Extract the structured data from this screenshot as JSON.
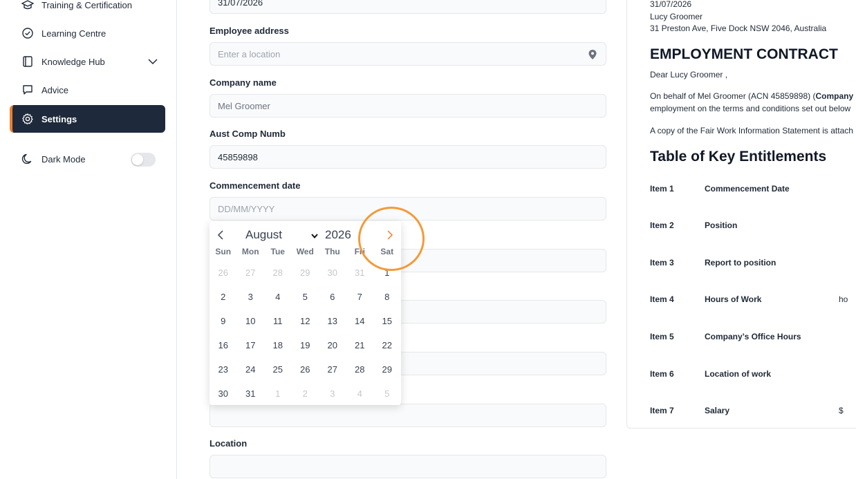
{
  "sidebar": {
    "items": [
      {
        "label": "Training & Certification",
        "icon": "graduation-cap-icon"
      },
      {
        "label": "Learning Centre",
        "icon": "check-circle-icon"
      },
      {
        "label": "Knowledge Hub",
        "icon": "book-icon"
      },
      {
        "label": "Advice",
        "icon": "chat-bubble-icon"
      },
      {
        "label": "Settings",
        "icon": "gear-icon"
      }
    ],
    "dark_mode_label": "Dark Mode",
    "dark_mode_on": false,
    "accent_color": "#f07f2d",
    "active_bg": "#1e2a3b"
  },
  "form": {
    "top_value": "31/07/2026",
    "employee_address": {
      "label": "Employee address",
      "placeholder": "Enter a location"
    },
    "company_name": {
      "label": "Company name",
      "value": "Mel Groomer"
    },
    "aust_comp_numb": {
      "label": "Aust Comp Numb",
      "value": "45859898"
    },
    "commencement_date": {
      "label": "Commencement date",
      "placeholder": "DD/MM/YYYY"
    },
    "location": {
      "label": "Location"
    }
  },
  "calendar": {
    "month": "August",
    "year": "2026",
    "weekdays": [
      "Sun",
      "Mon",
      "Tue",
      "Wed",
      "Thu",
      "Fri",
      "Sat"
    ],
    "weeks": [
      [
        "26",
        "27",
        "28",
        "29",
        "30",
        "31",
        "1"
      ],
      [
        "2",
        "3",
        "4",
        "5",
        "6",
        "7",
        "8"
      ],
      [
        "9",
        "10",
        "11",
        "12",
        "13",
        "14",
        "15"
      ],
      [
        "16",
        "17",
        "18",
        "19",
        "20",
        "21",
        "22"
      ],
      [
        "23",
        "24",
        "25",
        "26",
        "27",
        "28",
        "29"
      ],
      [
        "30",
        "31",
        "1",
        "2",
        "3",
        "4",
        "5"
      ]
    ]
  },
  "preview": {
    "date": "31/07/2026",
    "name": "Lucy Groomer",
    "address": "31 Preston Ave, Five Dock NSW 2046, Australia",
    "title": "EMPLOYMENT CONTRACT",
    "greeting": "Dear Lucy Groomer ,",
    "para1_line1_pre": "On behalf of Mel Groomer (ACN 45859898) (",
    "para1_line1_bold": "Company",
    "para1_line2": "employment on the terms and conditions set out below",
    "para2": "A copy of the Fair Work Information Statement is attach",
    "table_title": "Table of Key Entitlements",
    "rows": [
      {
        "item": "Item 1",
        "label": "Commencement Date",
        "value": ""
      },
      {
        "item": "Item 2",
        "label": "Position",
        "value": ""
      },
      {
        "item": "Item 3",
        "label": "Report to position",
        "value": ""
      },
      {
        "item": "Item 4",
        "label": "Hours of Work",
        "value": "ho"
      },
      {
        "item": "Item 5",
        "label": "Company’s Office Hours",
        "value": ""
      },
      {
        "item": "Item 6",
        "label": "Location of work",
        "value": ""
      },
      {
        "item": "Item 7",
        "label": "Salary",
        "value": "$"
      }
    ]
  }
}
